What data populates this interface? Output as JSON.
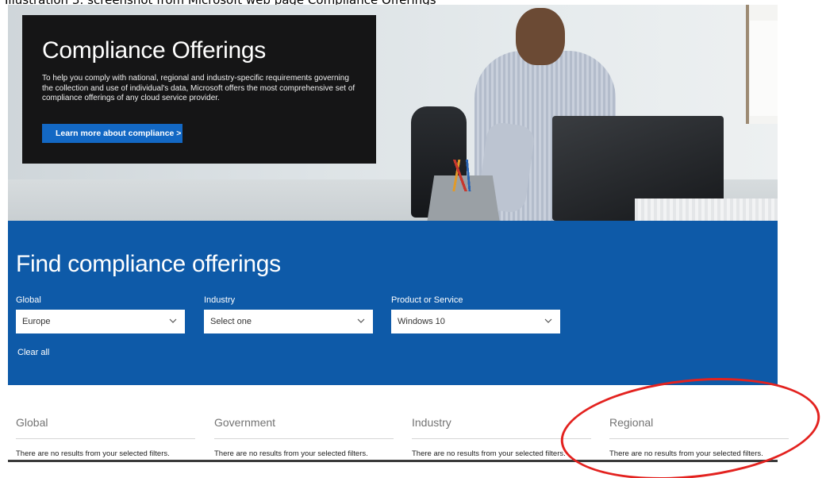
{
  "caption": "Illustration 3: screenshot from Microsoft web page Compliance Offerings",
  "hero": {
    "title": "Compliance Offerings",
    "description": "To help you comply with national, regional and industry-specific requirements governing the collection and use of individual's data, Microsoft offers the most comprehensive set of compliance offerings of any cloud service provider.",
    "cta_label": "Learn more about compliance >"
  },
  "finder": {
    "title": "Find compliance offerings",
    "filters": [
      {
        "label": "Global",
        "value": "Europe"
      },
      {
        "label": "Industry",
        "value": "Select one"
      },
      {
        "label": "Product or Service",
        "value": "Windows 10"
      }
    ],
    "clear_label": "Clear all"
  },
  "results": [
    {
      "title": "Global",
      "message": "There are no results from your selected filters."
    },
    {
      "title": "Government",
      "message": "There are no results from your selected filters."
    },
    {
      "title": "Industry",
      "message": "There are no results from your selected filters."
    },
    {
      "title": "Regional",
      "message": "There are no results from your selected filters."
    }
  ],
  "colors": {
    "brand_blue": "#0e5aa8",
    "button_blue": "#1368c4",
    "annotation_red": "#e3221f"
  },
  "icons": {
    "dropdown": "chevron-down-icon"
  }
}
